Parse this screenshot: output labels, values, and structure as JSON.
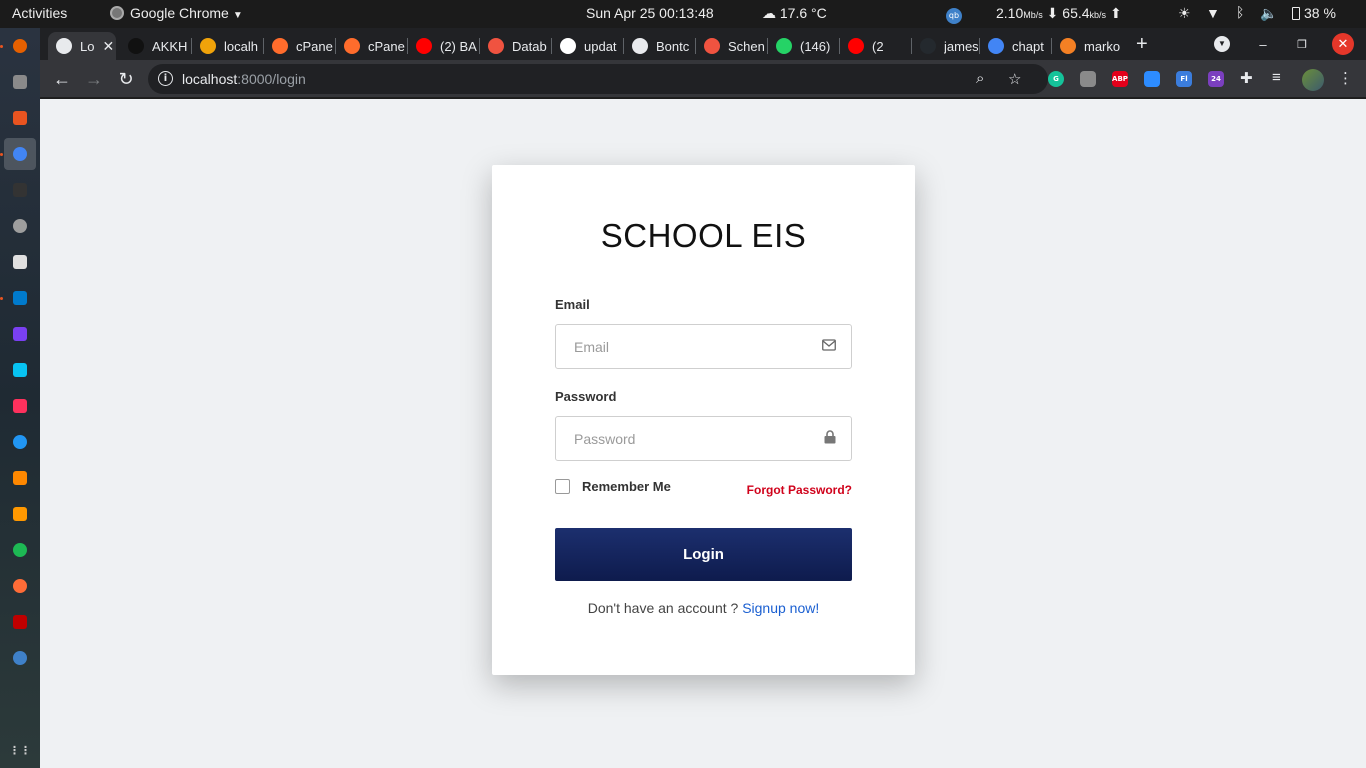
{
  "system": {
    "activities": "Activities",
    "app_name": "Google Chrome",
    "datetime": "Sun Apr 25  00:13:48",
    "weather": "17.6 °C",
    "net_down": "2.10",
    "net_down_unit": "Mb/s",
    "net_up": "65.4",
    "net_up_unit": "kb/s",
    "battery": "38 %"
  },
  "dock": {
    "items": [
      {
        "name": "Firefox",
        "icon": "firefox-icon",
        "color": "#e66000"
      },
      {
        "name": "Files",
        "icon": "files-icon",
        "color": "#8a8a8a"
      },
      {
        "name": "Ubuntu Software",
        "icon": "software-icon",
        "color": "#e95420"
      },
      {
        "name": "Google Chrome",
        "icon": "chrome-icon",
        "color": "#4285f4"
      },
      {
        "name": "Terminal",
        "icon": "terminal-icon",
        "color": "#333333"
      },
      {
        "name": "Disks",
        "icon": "disks-icon",
        "color": "#9e9e9e"
      },
      {
        "name": "Settings",
        "icon": "settings-icon",
        "color": "#e0e0e0"
      },
      {
        "name": "VS Code",
        "icon": "vscode-icon",
        "color": "#007acc"
      },
      {
        "name": "PhpStorm",
        "icon": "phpstorm-icon",
        "color": "#7a40f2"
      },
      {
        "name": "WebStorm",
        "icon": "webstorm-icon",
        "color": "#07c3f2"
      },
      {
        "name": "IntelliJ",
        "icon": "intellij-icon",
        "color": "#fe315d"
      },
      {
        "name": "Remmina",
        "icon": "remmina-icon",
        "color": "#2196f3"
      },
      {
        "name": "VLC",
        "icon": "vlc-icon",
        "color": "#ff8800"
      },
      {
        "name": "Sublime Text",
        "icon": "sublime-icon",
        "color": "#ff9800"
      },
      {
        "name": "Spotify",
        "icon": "spotify-icon",
        "color": "#1db954"
      },
      {
        "name": "Postman",
        "icon": "postman-icon",
        "color": "#ff6c37"
      },
      {
        "name": "FileZilla",
        "icon": "filezilla-icon",
        "color": "#bf0000"
      },
      {
        "name": "qBittorrent",
        "icon": "qbittorrent-icon",
        "color": "#3f81c9"
      },
      {
        "name": "Show Applications",
        "icon": "app-grid-icon",
        "color": "#cccccc"
      }
    ]
  },
  "browser": {
    "tabs": [
      {
        "title": "Lo",
        "icon": "globe-icon",
        "color": "#e8eaed",
        "active": true
      },
      {
        "title": "AKKH",
        "icon": "akkh-icon",
        "color": "#111111"
      },
      {
        "title": "localh",
        "icon": "pma-icon",
        "color": "#f0a30a"
      },
      {
        "title": "cPane",
        "icon": "cpanel-icon",
        "color": "#ff6c2c"
      },
      {
        "title": "cPane",
        "icon": "cpanel-icon",
        "color": "#ff6c2c"
      },
      {
        "title": "(2) BA",
        "icon": "youtube-icon",
        "color": "#ff0000"
      },
      {
        "title": "Datab",
        "icon": "laravel-icon",
        "color": "#f05340"
      },
      {
        "title": "updat",
        "icon": "google-icon",
        "color": "#ffffff"
      },
      {
        "title": "Bontc",
        "icon": "globe-icon",
        "color": "#e8eaed"
      },
      {
        "title": "Schen",
        "icon": "laravel-icon",
        "color": "#f05340"
      },
      {
        "title": "(146)",
        "icon": "whatsapp-icon",
        "color": "#25d366"
      },
      {
        "title": "(2",
        "icon": "youtube-icon",
        "color": "#ff0000"
      },
      {
        "title": "james",
        "icon": "github-icon",
        "color": "#24292e"
      },
      {
        "title": "chapt",
        "icon": "docs-icon",
        "color": "#4285f4"
      },
      {
        "title": "marko",
        "icon": "stackoverflow-icon",
        "color": "#f48024"
      }
    ],
    "url_host": "localhost",
    "url_rest": ":8000/login",
    "extensions": [
      {
        "name": "grammarly-icon",
        "label": "G",
        "color": "#15c39a"
      },
      {
        "name": "extension-gray-icon",
        "label": "",
        "color": "#8a8a8a"
      },
      {
        "name": "adblock-icon",
        "label": "ABP",
        "color": "#e4001b"
      },
      {
        "name": "zoom-ext-icon",
        "label": "",
        "color": "#2d8cff"
      },
      {
        "name": "fl-ext-icon",
        "label": "Fl",
        "color": "#3b7ddd"
      },
      {
        "name": "badge-ext-icon",
        "label": "24",
        "color": "#7b3fbf"
      }
    ]
  },
  "login": {
    "title": "SCHOOL EIS",
    "email_label": "Email",
    "email_placeholder": "Email",
    "password_label": "Password",
    "password_placeholder": "Password",
    "remember_label": "Remember Me",
    "forgot_label": "Forgot Password?",
    "login_button": "Login",
    "signup_prompt": "Don't have an account ?",
    "signup_link": "Signup now!"
  },
  "colors": {
    "login_button": "#142560",
    "forgot_link": "#d0021b",
    "signup_link": "#1a5fd1",
    "page_background": "#eff1f3"
  }
}
